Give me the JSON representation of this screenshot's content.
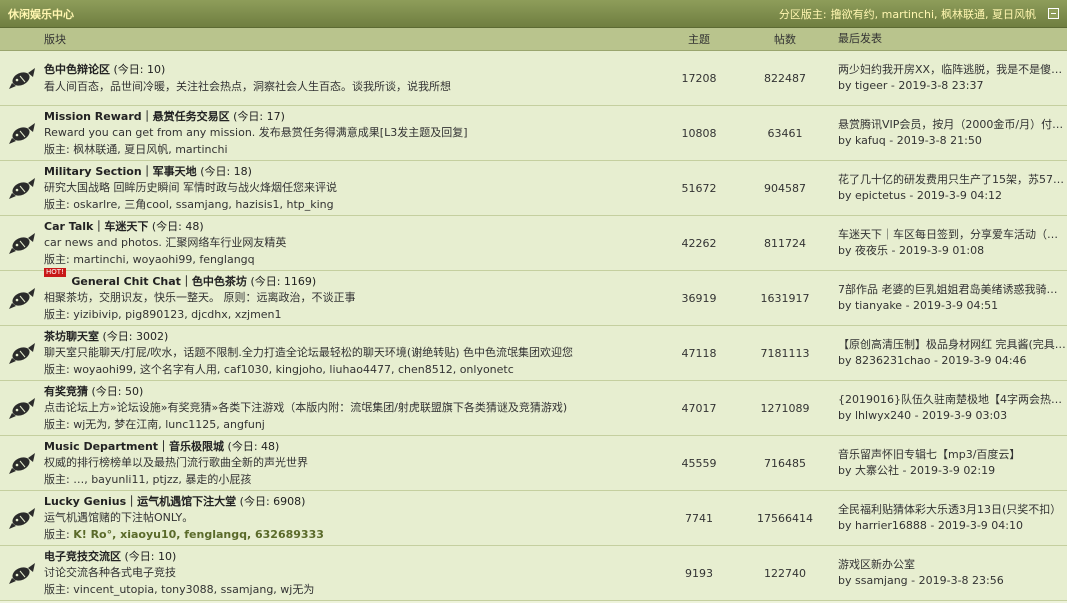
{
  "header": {
    "title": "休闲娱乐中心",
    "mods_prefix": "分区版主:",
    "mods": "撸欲有约, martinchi, 枫林联通, 夏日风帆"
  },
  "columns": {
    "forum": "版块",
    "topics": "主题",
    "posts": "帖数",
    "last": "最后发表"
  },
  "forums": [
    {
      "name": "色中色辩论区",
      "today": "(今日: 10)",
      "desc": "看人间百态，品世间冷暖，关注社会热点，洞察社会人生百态。谈我所谈，说我所想",
      "mods": "",
      "topics": "17208",
      "posts": "822487",
      "last_title": "两少妇约我开房XX，临阵逃脱，我是不是傻B？…",
      "last_by": "by tigeer - 2019-3-8 23:37"
    },
    {
      "name": "Mission Reward｜悬赏任务交易区",
      "today": "(今日: 17)",
      "desc": "Reward you can get from any mission. 发布悬赏任务得满意成果[L3发主题及回复]",
      "mods": "版主: 枫林联通, 夏日风帆, martinchi",
      "topics": "10808",
      "posts": "63461",
      "last_title": "悬赏腾讯VIP会员，按月（2000金币/月）付费 ...",
      "last_by": "by kafuq - 2019-3-8 21:50"
    },
    {
      "name": "Military Section｜军事天地",
      "today": "(今日: 18)",
      "desc": "研究大国战略 回眸历史瞬间 军情时政与战火烽烟任您来评说",
      "mods": "版主: oskarlre, 三角cool, ssamjang, hazisis1, htp_king",
      "topics": "51672",
      "posts": "904587",
      "last_title": "花了几十亿的研发费用只生产了15架，苏57还 ...",
      "last_by": "by epictetus - 2019-3-9 04:12"
    },
    {
      "name": "Car Talk｜车迷天下",
      "today": "(今日: 48)",
      "desc": "car news and photos. 汇聚网络车行业网友精英",
      "mods": "版主: martinchi, woyaohi99, fenglangq",
      "topics": "42262",
      "posts": "811724",
      "last_title": "车迷天下｜车区每日签到，分享爱车活动（第 ...",
      "last_by": "by 夜夜乐 - 2019-3-9 01:08"
    },
    {
      "name": "General Chit Chat｜色中色茶坊",
      "today": "(今日: 1169)",
      "hot": "HOT!",
      "desc": "相聚茶坊，交朋识友，快乐一整天。 原则：远离政治，不谈正事",
      "mods": "版主: yizibivip, pig890123, djcdhx, xzjmen1",
      "topics": "36919",
      "posts": "1631917",
      "last_title": "7部作品 老婆的巨乳姐姐君岛美绪诱惑我骑乘 ...",
      "last_by": "by tianyake - 2019-3-9 04:51"
    },
    {
      "name": "茶坊聊天室",
      "today": "(今日: 3002)",
      "desc": "聊天室只能聊天/打屁/吹水，话题不限制.全力打造全论坛最轻松的聊天环境(谢绝转贴) 色中色流氓集团欢迎您",
      "mods": "版主: woyaohi99, 这个名字有人用, caf1030, kingjoho, liuhao4477, chen8512, onlyonetc",
      "topics": "47118",
      "posts": "7181113",
      "last_title": "【原创高清压制】极品身材网红 完具酱(完具 ...",
      "last_by": "by 8236231chao - 2019-3-9 04:46"
    },
    {
      "name": "有奖竞猜",
      "today": "(今日: 50)",
      "desc": "点击论坛上方»论坛设施»有奖竞猜»各类下注游戏（本版内附：流氓集团/射虎联盟旗下各类猜谜及竞猜游戏)",
      "mods": "版主: wj无为, 梦在江南, lunc1125, angfunj",
      "topics": "47017",
      "posts": "1271089",
      "last_title": "{2019016}队伍久驻南楚极地【4字两会热词】",
      "last_by": "by lhlwyx240 - 2019-3-9 03:03"
    },
    {
      "name": "Music Department｜音乐极限城",
      "today": "(今日: 48)",
      "desc": "权威的排行榜榜单以及最热门流行歌曲全新的声光世界",
      "mods": "版主: …, bayunli11, ptjzz, 暴走的小屁孩",
      "topics": "45559",
      "posts": "716485",
      "last_title": "音乐留声怀旧专辑七【mp3/百度云】",
      "last_by": "by 大寨公社 - 2019-3-9 02:19"
    },
    {
      "name": "Lucky Genius｜运气机遇馆下注大堂",
      "today": "(今日: 6908)",
      "desc": "运气机遇馆赌的下注帖ONLY。",
      "mods_prefix": "版主: ",
      "mods_bold": "K! Ro°, xiaoyu10, fenglangq, 632689333",
      "topics": "7741",
      "posts": "17566414",
      "last_title": "全民福利贴猜体彩大乐透3月13日(只奖不扣）",
      "last_by": "by harrier16888 - 2019-3-9 04:10"
    },
    {
      "name": "电子竞技交流区",
      "today": "(今日: 10)",
      "desc": "讨论交流各种各式电子竞技",
      "mods": "版主: vincent_utopia, tony3088, ssamjang, wj无为",
      "topics": "9193",
      "posts": "122740",
      "last_title": "游戏区新办公室",
      "last_by": "by ssamjang - 2019-3-8 23:56"
    }
  ],
  "colors": {
    "header_bg": "#7d8c4c",
    "header_text": "#fff6b0",
    "row_bg": "#e7eed0",
    "colhead_bg": "#b9c48d"
  },
  "icons": {
    "forum": "fish-icon",
    "collapse": "collapse-icon"
  }
}
